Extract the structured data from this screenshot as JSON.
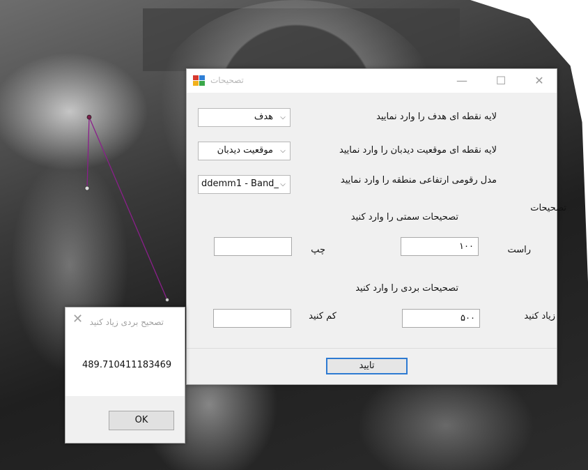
{
  "dialog": {
    "title": "تصحیحات",
    "target_layer_label": "لایه نقطه ای هدف را وارد نمایید",
    "target_layer_value": "هدف",
    "observer_layer_label": "لایه نقطه ای موقعیت دیدبان را وارد نمایید",
    "observer_layer_value": "موقعیت دیدبان",
    "dem_label": "مدل رقومی ارتفاعی منطقه را وارد نمایید",
    "dem_value": "ddemm1 - Band_",
    "corrections_heading": "تصحیحات",
    "azimuth_heading": "تصحیحات سمتی را وارد کنید",
    "right_label": "راست",
    "right_value": "۱۰۰",
    "left_label": "چپ",
    "left_value": "",
    "range_heading": "تصحیحات بردی را وارد کنید",
    "increase_label": "زیاد کنید",
    "increase_value": "۵۰۰",
    "decrease_label": "کم کنید",
    "decrease_value": "",
    "confirm_button": "تایید",
    "minimize_symbol": "—",
    "maximize_symbol": "☐",
    "close_symbol": "✕"
  },
  "message_box": {
    "title": "تصحیح بردی زیاد کنید",
    "close_symbol": "✕",
    "text": "489.710411183469",
    "ok_button": "OK"
  },
  "colors": {
    "accent": "#2d7ad2",
    "line": "#8b1f8b"
  }
}
